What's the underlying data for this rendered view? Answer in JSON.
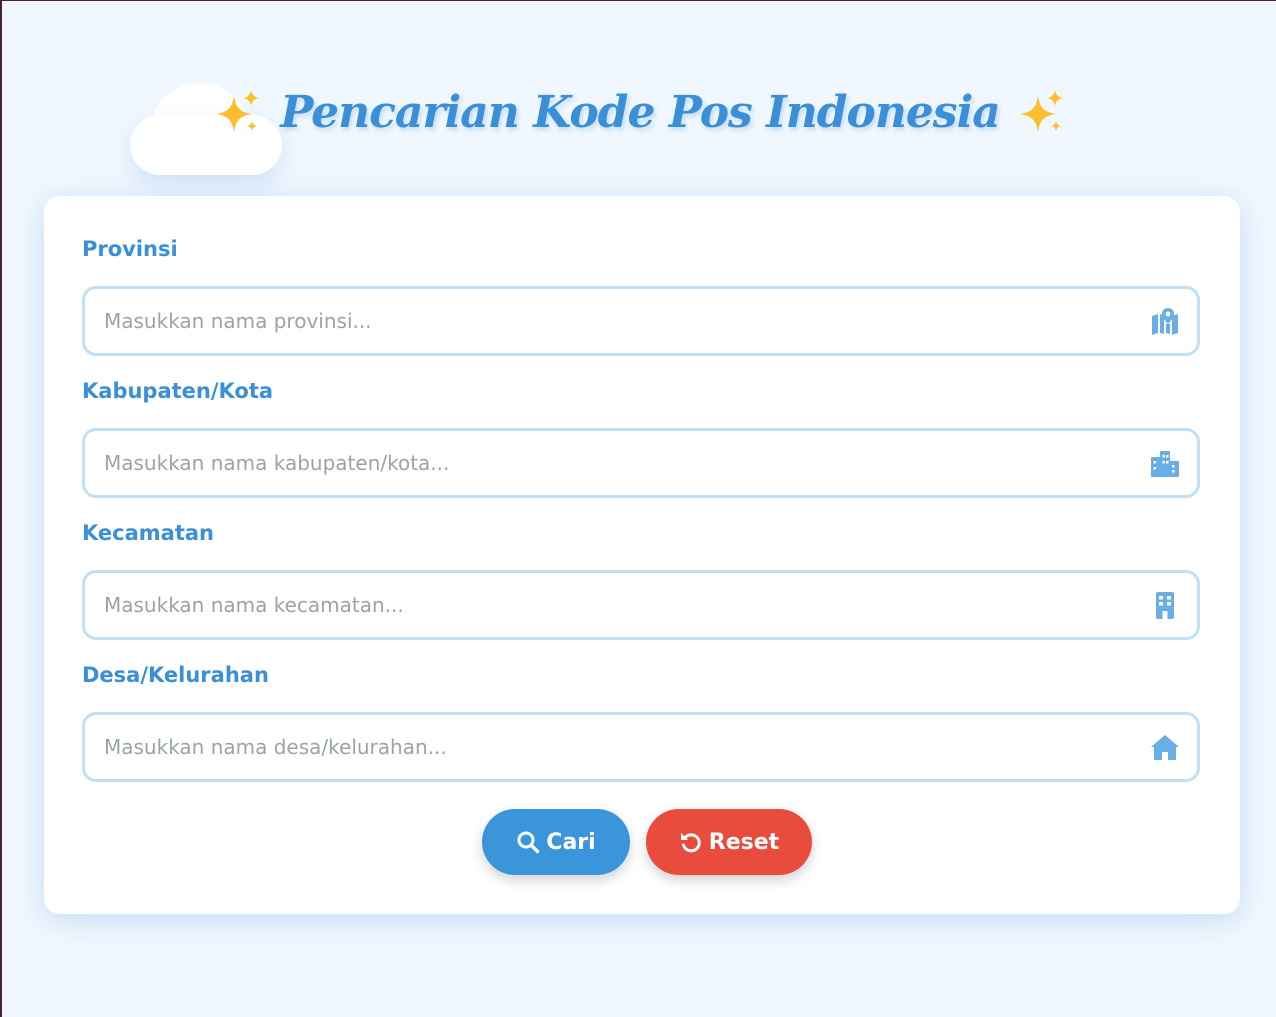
{
  "header": {
    "sparkle_left": "✨",
    "title": "Pencarian Kode Pos Indonesia",
    "sparkle_right": "✨"
  },
  "form": {
    "fields": [
      {
        "label": "Provinsi",
        "placeholder": "Masukkan nama provinsi...",
        "value": "",
        "icon": "map-location-icon"
      },
      {
        "label": "Kabupaten/Kota",
        "placeholder": "Masukkan nama kabupaten/kota...",
        "value": "",
        "icon": "city-icon"
      },
      {
        "label": "Kecamatan",
        "placeholder": "Masukkan nama kecamatan...",
        "value": "",
        "icon": "building-icon"
      },
      {
        "label": "Desa/Kelurahan",
        "placeholder": "Masukkan nama desa/kelurahan...",
        "value": "",
        "icon": "house-icon"
      }
    ]
  },
  "buttons": {
    "search_label": "Cari",
    "search_icon": "search-icon",
    "reset_label": "Reset",
    "reset_icon": "rotate-left-icon"
  },
  "colors": {
    "background": "#f0f7fe",
    "accent": "#3a8fd6",
    "search_button": "#3a95da",
    "reset_button": "#e94b3c",
    "input_border": "#bfe0f7",
    "icon": "#6aaee6"
  }
}
